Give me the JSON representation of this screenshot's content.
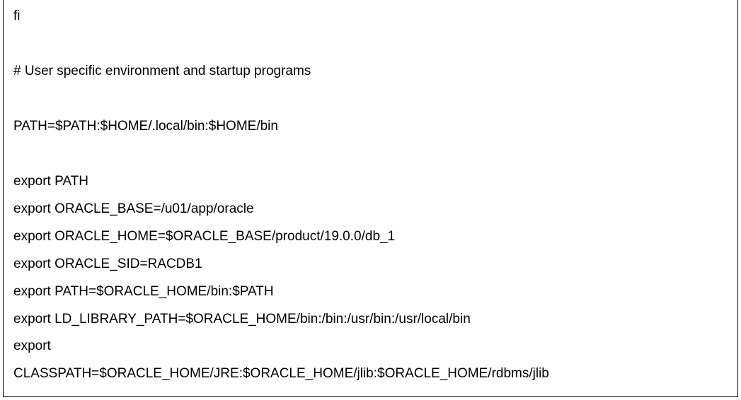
{
  "lines": {
    "l1": "fi",
    "l2": "# User specific environment and startup programs",
    "l3": "PATH=$PATH:$HOME/.local/bin:$HOME/bin",
    "l4": "export PATH",
    "l5": "export ORACLE_BASE=/u01/app/oracle",
    "l6": "export ORACLE_HOME=$ORACLE_BASE/product/19.0.0/db_1",
    "l7": "export ORACLE_SID=RACDB1",
    "l8": "export PATH=$ORACLE_HOME/bin:$PATH",
    "l9": "export LD_LIBRARY_PATH=$ORACLE_HOME/bin:/bin:/usr/bin:/usr/local/bin",
    "l10": "export",
    "l11": "CLASSPATH=$ORACLE_HOME/JRE:$ORACLE_HOME/jlib:$ORACLE_HOME/rdbms/jlib"
  }
}
